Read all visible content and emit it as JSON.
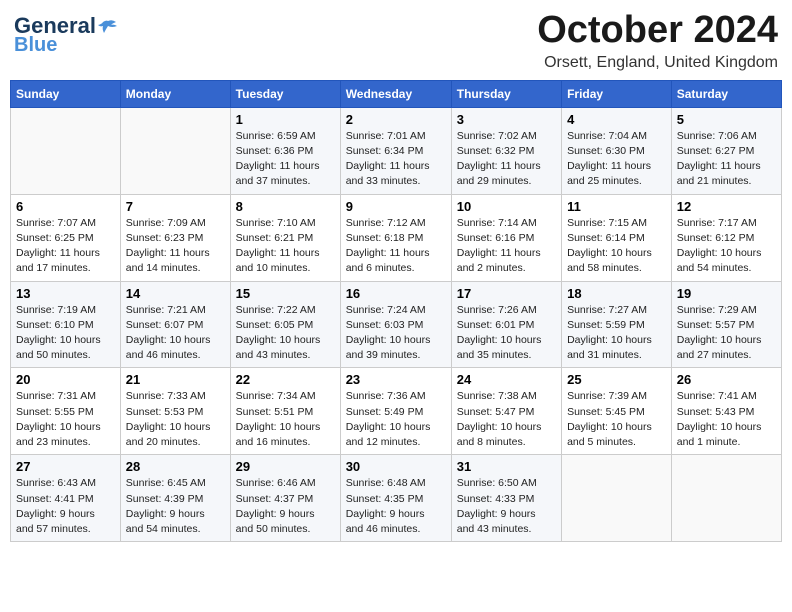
{
  "header": {
    "logo_line1": "General",
    "logo_line2": "Blue",
    "month_title": "October 2024",
    "location": "Orsett, England, United Kingdom"
  },
  "days_of_week": [
    "Sunday",
    "Monday",
    "Tuesday",
    "Wednesday",
    "Thursday",
    "Friday",
    "Saturday"
  ],
  "weeks": [
    [
      {
        "day": "",
        "info": ""
      },
      {
        "day": "",
        "info": ""
      },
      {
        "day": "1",
        "info": "Sunrise: 6:59 AM\nSunset: 6:36 PM\nDaylight: 11 hours\nand 37 minutes."
      },
      {
        "day": "2",
        "info": "Sunrise: 7:01 AM\nSunset: 6:34 PM\nDaylight: 11 hours\nand 33 minutes."
      },
      {
        "day": "3",
        "info": "Sunrise: 7:02 AM\nSunset: 6:32 PM\nDaylight: 11 hours\nand 29 minutes."
      },
      {
        "day": "4",
        "info": "Sunrise: 7:04 AM\nSunset: 6:30 PM\nDaylight: 11 hours\nand 25 minutes."
      },
      {
        "day": "5",
        "info": "Sunrise: 7:06 AM\nSunset: 6:27 PM\nDaylight: 11 hours\nand 21 minutes."
      }
    ],
    [
      {
        "day": "6",
        "info": "Sunrise: 7:07 AM\nSunset: 6:25 PM\nDaylight: 11 hours\nand 17 minutes."
      },
      {
        "day": "7",
        "info": "Sunrise: 7:09 AM\nSunset: 6:23 PM\nDaylight: 11 hours\nand 14 minutes."
      },
      {
        "day": "8",
        "info": "Sunrise: 7:10 AM\nSunset: 6:21 PM\nDaylight: 11 hours\nand 10 minutes."
      },
      {
        "day": "9",
        "info": "Sunrise: 7:12 AM\nSunset: 6:18 PM\nDaylight: 11 hours\nand 6 minutes."
      },
      {
        "day": "10",
        "info": "Sunrise: 7:14 AM\nSunset: 6:16 PM\nDaylight: 11 hours\nand 2 minutes."
      },
      {
        "day": "11",
        "info": "Sunrise: 7:15 AM\nSunset: 6:14 PM\nDaylight: 10 hours\nand 58 minutes."
      },
      {
        "day": "12",
        "info": "Sunrise: 7:17 AM\nSunset: 6:12 PM\nDaylight: 10 hours\nand 54 minutes."
      }
    ],
    [
      {
        "day": "13",
        "info": "Sunrise: 7:19 AM\nSunset: 6:10 PM\nDaylight: 10 hours\nand 50 minutes."
      },
      {
        "day": "14",
        "info": "Sunrise: 7:21 AM\nSunset: 6:07 PM\nDaylight: 10 hours\nand 46 minutes."
      },
      {
        "day": "15",
        "info": "Sunrise: 7:22 AM\nSunset: 6:05 PM\nDaylight: 10 hours\nand 43 minutes."
      },
      {
        "day": "16",
        "info": "Sunrise: 7:24 AM\nSunset: 6:03 PM\nDaylight: 10 hours\nand 39 minutes."
      },
      {
        "day": "17",
        "info": "Sunrise: 7:26 AM\nSunset: 6:01 PM\nDaylight: 10 hours\nand 35 minutes."
      },
      {
        "day": "18",
        "info": "Sunrise: 7:27 AM\nSunset: 5:59 PM\nDaylight: 10 hours\nand 31 minutes."
      },
      {
        "day": "19",
        "info": "Sunrise: 7:29 AM\nSunset: 5:57 PM\nDaylight: 10 hours\nand 27 minutes."
      }
    ],
    [
      {
        "day": "20",
        "info": "Sunrise: 7:31 AM\nSunset: 5:55 PM\nDaylight: 10 hours\nand 23 minutes."
      },
      {
        "day": "21",
        "info": "Sunrise: 7:33 AM\nSunset: 5:53 PM\nDaylight: 10 hours\nand 20 minutes."
      },
      {
        "day": "22",
        "info": "Sunrise: 7:34 AM\nSunset: 5:51 PM\nDaylight: 10 hours\nand 16 minutes."
      },
      {
        "day": "23",
        "info": "Sunrise: 7:36 AM\nSunset: 5:49 PM\nDaylight: 10 hours\nand 12 minutes."
      },
      {
        "day": "24",
        "info": "Sunrise: 7:38 AM\nSunset: 5:47 PM\nDaylight: 10 hours\nand 8 minutes."
      },
      {
        "day": "25",
        "info": "Sunrise: 7:39 AM\nSunset: 5:45 PM\nDaylight: 10 hours\nand 5 minutes."
      },
      {
        "day": "26",
        "info": "Sunrise: 7:41 AM\nSunset: 5:43 PM\nDaylight: 10 hours\nand 1 minute."
      }
    ],
    [
      {
        "day": "27",
        "info": "Sunrise: 6:43 AM\nSunset: 4:41 PM\nDaylight: 9 hours\nand 57 minutes."
      },
      {
        "day": "28",
        "info": "Sunrise: 6:45 AM\nSunset: 4:39 PM\nDaylight: 9 hours\nand 54 minutes."
      },
      {
        "day": "29",
        "info": "Sunrise: 6:46 AM\nSunset: 4:37 PM\nDaylight: 9 hours\nand 50 minutes."
      },
      {
        "day": "30",
        "info": "Sunrise: 6:48 AM\nSunset: 4:35 PM\nDaylight: 9 hours\nand 46 minutes."
      },
      {
        "day": "31",
        "info": "Sunrise: 6:50 AM\nSunset: 4:33 PM\nDaylight: 9 hours\nand 43 minutes."
      },
      {
        "day": "",
        "info": ""
      },
      {
        "day": "",
        "info": ""
      }
    ]
  ]
}
